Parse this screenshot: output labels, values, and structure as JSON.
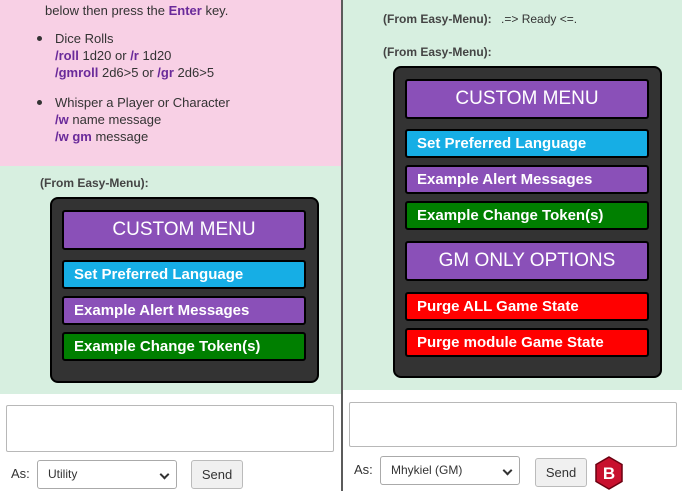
{
  "colors": {
    "pink_bg": "#f8d0e5",
    "chat_green": "#d7efe0",
    "menu_dark": "#333333",
    "purple": "#8a50b8",
    "blue": "#16aee5",
    "green": "#007f00",
    "red": "#ff0000",
    "keyword_purple": "#6a2a9a"
  },
  "left": {
    "help": {
      "intro_pre": "below then press the",
      "intro_key": "Enter",
      "intro_post": "key.",
      "items": [
        {
          "title": "Dice Rolls",
          "line1_cmd1": "/roll",
          "line1_arg1": "1d20 or",
          "line1_cmd2": "/r",
          "line1_arg2": "1d20",
          "line2_cmd1": "/gmroll",
          "line2_arg1": "2d6>5 or",
          "line2_cmd2": "/gr",
          "line2_arg2": "2d6>5"
        },
        {
          "title": "Whisper a Player or Character",
          "line1_cmd1": "/w",
          "line1_arg1": "name message",
          "line2_cmd1": "/w gm",
          "line2_arg1": "message"
        }
      ]
    },
    "message": {
      "sender": "(From Easy-Menu):",
      "header": "CUSTOM MENU",
      "buttons": [
        {
          "label": "Set Preferred Language",
          "color": "#16aee5"
        },
        {
          "label": "Example Alert Messages",
          "color": "#8a50b8"
        },
        {
          "label": "Example Change Token(s)",
          "color": "#007f00"
        }
      ]
    },
    "as_label": "As:",
    "as_value": "Utility",
    "send_label": "Send"
  },
  "right": {
    "status": {
      "sender": "(From Easy-Menu):",
      "text": ".=> Ready <=."
    },
    "message": {
      "sender": "(From Easy-Menu):",
      "header1": "CUSTOM MENU",
      "buttons1": [
        {
          "label": "Set Preferred Language",
          "color": "#16aee5"
        },
        {
          "label": "Example Alert Messages",
          "color": "#8a50b8"
        },
        {
          "label": "Example Change Token(s)",
          "color": "#007f00"
        }
      ],
      "header2": "GM ONLY OPTIONS",
      "buttons2": [
        {
          "label": "Purge ALL Game State",
          "color": "#ff0000"
        },
        {
          "label": "Purge module Game State",
          "color": "#ff0000"
        }
      ]
    },
    "as_label": "As:",
    "as_value": "Mhykiel (GM)",
    "send_label": "Send",
    "badge_letter": "B"
  }
}
